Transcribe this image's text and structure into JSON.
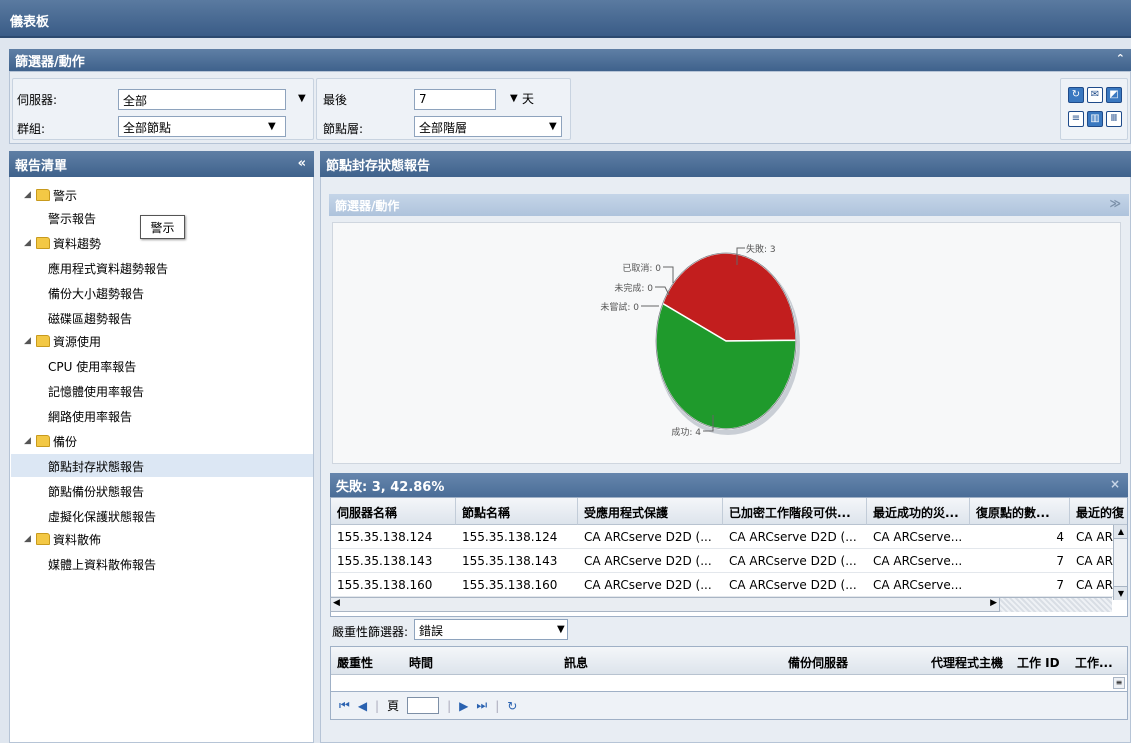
{
  "window": {
    "title": "儀表板"
  },
  "filter": {
    "title": "篩選器/動作",
    "server_label": "伺服器:",
    "server_value": "全部",
    "group_label": "群組:",
    "group_value": "全部節點",
    "last_label": "最後",
    "last_value": "7",
    "days_label": "天",
    "tier_label": "節點層:",
    "tier_value": "全部階層"
  },
  "report_list": {
    "title": "報告清單",
    "collapse_glyph": "«",
    "tooltip": "警示",
    "folders": [
      {
        "label": "警示",
        "items": [
          "警示報告"
        ]
      },
      {
        "label": "資料趨勢",
        "items": [
          "應用程式資料趨勢報告",
          "備份大小趨勢報告",
          "磁碟區趨勢報告"
        ]
      },
      {
        "label": "資源使用",
        "items": [
          "CPU 使用率報告",
          "記憶體使用率報告",
          "網路使用率報告"
        ]
      },
      {
        "label": "備份",
        "items": [
          "節點封存狀態報告",
          "節點備份狀態報告",
          "虛擬化保護狀態報告"
        ]
      },
      {
        "label": "資料散佈",
        "items": [
          "媒體上資料散佈報告"
        ]
      }
    ],
    "selected": "節點封存狀態報告"
  },
  "report": {
    "title": "節點封存狀態報告",
    "inner_filter_title": "篩選器/動作",
    "expand_glyph": "≫"
  },
  "chart_data": {
    "type": "pie",
    "categories": [
      "失敗",
      "成功",
      "已取消",
      "未完成",
      "未嘗試"
    ],
    "values": [
      3,
      4,
      0,
      0,
      0
    ],
    "labels": [
      "失敗: 3",
      "成功: 4",
      "已取消: 0",
      "未完成: 0",
      "未嘗試: 0"
    ],
    "colors": [
      "#c21e1e",
      "#1f9a2c",
      "#888888",
      "#888888",
      "#888888"
    ]
  },
  "grid": {
    "title": "失敗: 3, 42.86%",
    "close_glyph": "×",
    "columns": [
      "伺服器名稱",
      "節點名稱",
      "受應用程式保護",
      "已加密工作階段可供...",
      "最近成功的災...",
      "復原點的數...",
      "最近的復"
    ],
    "rows": [
      [
        "155.35.138.124",
        "155.35.138.124",
        "CA ARCserve D2D (...",
        "CA ARCserve D2D (...",
        "CA ARCserve...",
        "4",
        "CA AR"
      ],
      [
        "155.35.138.143",
        "155.35.138.143",
        "CA ARCserve D2D (...",
        "CA ARCserve D2D (...",
        "CA ARCserve...",
        "7",
        "CA AR"
      ],
      [
        "155.35.138.160",
        "155.35.138.160",
        "CA ARCserve D2D (...",
        "CA ARCserve D2D (...",
        "CA ARCserve...",
        "7",
        "CA AR"
      ]
    ]
  },
  "severity": {
    "label": "嚴重性篩選器:",
    "value": "錯誤"
  },
  "log": {
    "columns": [
      "嚴重性",
      "時間",
      "訊息",
      "備份伺服器",
      "代理程式主機",
      "工作 ID",
      "工作..."
    ]
  },
  "pager": {
    "page_label": "頁",
    "page_value": ""
  }
}
